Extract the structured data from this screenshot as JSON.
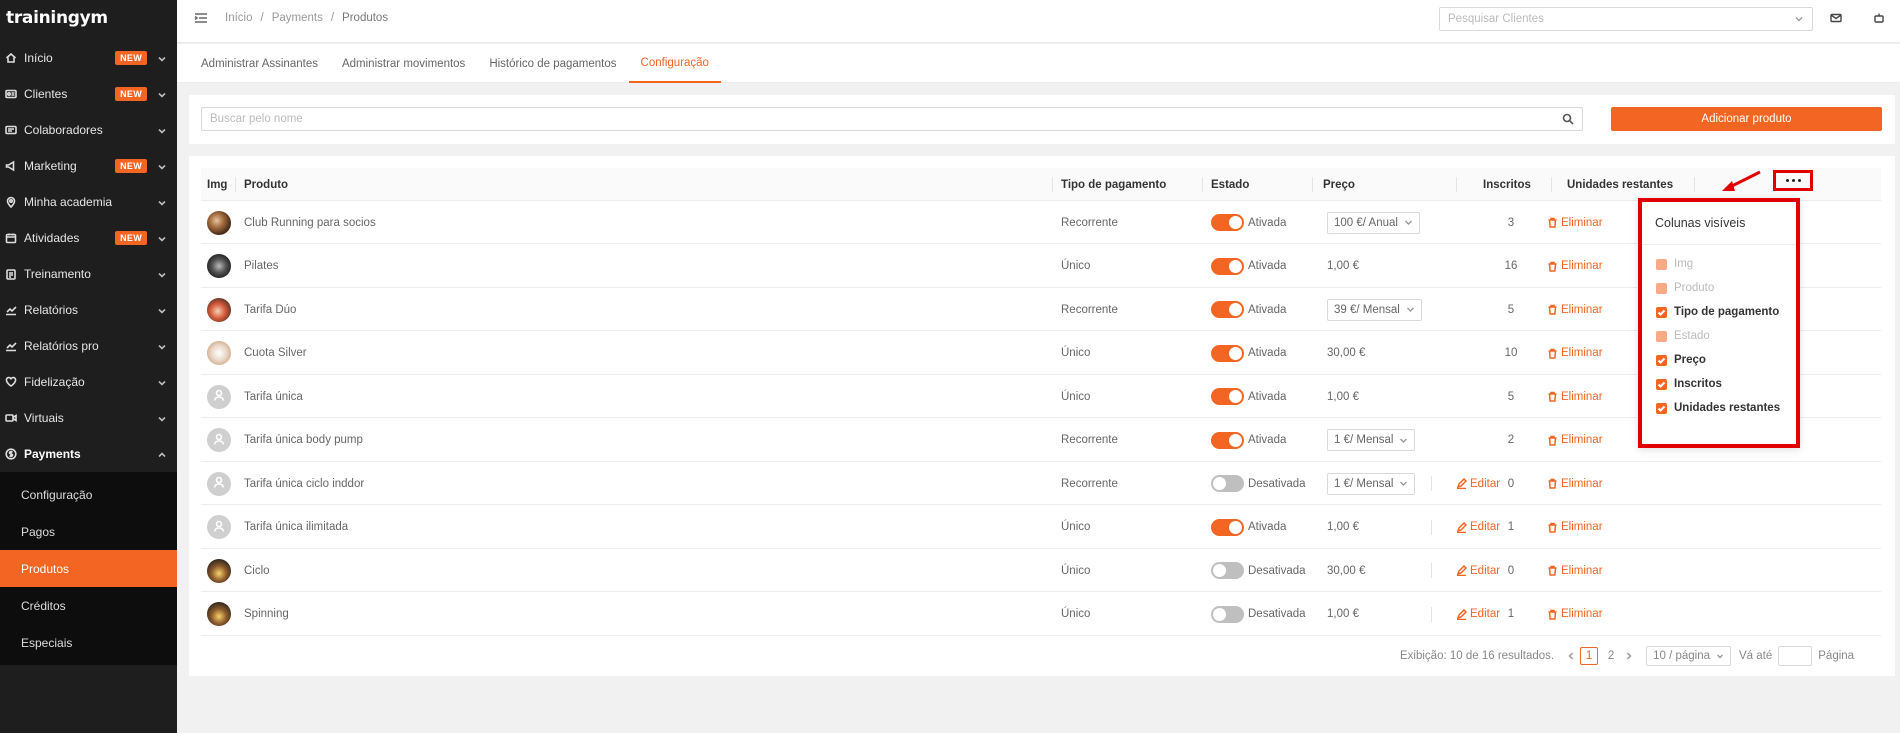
{
  "app": {
    "logo": "trainingym"
  },
  "sidebar": {
    "items": [
      {
        "label": "Início",
        "badge": "NEW",
        "icon": "home-icon"
      },
      {
        "label": "Clientes",
        "badge": "NEW",
        "icon": "id-card-icon"
      },
      {
        "label": "Colaboradores",
        "badge": "",
        "icon": "id-badge-icon"
      },
      {
        "label": "Marketing",
        "badge": "NEW",
        "icon": "megaphone-icon"
      },
      {
        "label": "Minha academia",
        "badge": "",
        "icon": "location-pin-icon"
      },
      {
        "label": "Atividades",
        "badge": "NEW",
        "icon": "calendar-icon"
      },
      {
        "label": "Treinamento",
        "badge": "",
        "icon": "clipboard-icon"
      },
      {
        "label": "Relatórios",
        "badge": "",
        "icon": "line-chart-icon"
      },
      {
        "label": "Relatórios pro",
        "badge": "",
        "icon": "line-chart-icon"
      },
      {
        "label": "Fidelização",
        "badge": "",
        "icon": "heart-icon"
      },
      {
        "label": "Virtuais",
        "badge": "",
        "icon": "video-icon"
      },
      {
        "label": "Payments",
        "badge": "",
        "icon": "dollar-icon"
      }
    ],
    "payments_sub": [
      "Configuração",
      "Pagos",
      "Produtos",
      "Créditos",
      "Especiais"
    ]
  },
  "topbar": {
    "breadcrumb": [
      "Início",
      "/",
      "Payments",
      "/",
      "Produtos"
    ],
    "search_placeholder": "Pesquisar Clientes"
  },
  "tabs": [
    "Administrar Assinantes",
    "Administrar movimentos",
    "Histórico de pagamentos",
    "Configuração"
  ],
  "search": {
    "placeholder": "Buscar pelo nome",
    "add_button": "Adicionar produto"
  },
  "table": {
    "headers": {
      "img": "Img",
      "produto": "Produto",
      "tipo": "Tipo de pagamento",
      "estado": "Estado",
      "preco": "Preço",
      "inscritos": "Inscritos",
      "unidades": "Unidades restantes"
    },
    "actions": {
      "edit": "Editar",
      "delete": "Eliminar"
    },
    "rows": [
      {
        "name": "Club Running para socios",
        "tipo": "Recorrente",
        "on": true,
        "estado": "Ativada",
        "price": "100 €/ Anual",
        "price_select": true,
        "inscritos": "3",
        "avatar": "photo"
      },
      {
        "name": "Pilates",
        "tipo": "Único",
        "on": true,
        "estado": "Ativada",
        "price": "1,00 €",
        "price_select": false,
        "inscritos": "16",
        "avatar": "photo2"
      },
      {
        "name": "Tarifa Dúo",
        "tipo": "Recorrente",
        "on": true,
        "estado": "Ativada",
        "price": "39 €/ Mensal",
        "price_select": true,
        "inscritos": "5",
        "avatar": "photo3"
      },
      {
        "name": "Cuota Silver",
        "tipo": "Único",
        "on": true,
        "estado": "Ativada",
        "price": "30,00 €",
        "price_select": false,
        "inscritos": "10",
        "avatar": "photo4"
      },
      {
        "name": "Tarifa única",
        "tipo": "Único",
        "on": true,
        "estado": "Ativada",
        "price": "1,00 €",
        "price_select": false,
        "inscritos": "5",
        "avatar": "gray"
      },
      {
        "name": "Tarifa única body pump",
        "tipo": "Recorrente",
        "on": true,
        "estado": "Ativada",
        "price": "1 €/ Mensal",
        "price_select": true,
        "inscritos": "2",
        "avatar": "gray"
      },
      {
        "name": "Tarifa única ciclo inddor",
        "tipo": "Recorrente",
        "on": false,
        "estado": "Desativada",
        "price": "1 €/ Mensal",
        "price_select": true,
        "inscritos": "0",
        "avatar": "gray"
      },
      {
        "name": "Tarifa única ilimitada",
        "tipo": "Único",
        "on": true,
        "estado": "Ativada",
        "price": "1,00 €",
        "price_select": false,
        "inscritos": "1",
        "avatar": "gray"
      },
      {
        "name": "Ciclo",
        "tipo": "Único",
        "on": false,
        "estado": "Desativada",
        "price": "30,00 €",
        "price_select": false,
        "inscritos": "0",
        "avatar": "photo5"
      },
      {
        "name": "Spinning",
        "tipo": "Único",
        "on": false,
        "estado": "Desativada",
        "price": "1,00 €",
        "price_select": false,
        "inscritos": "1",
        "avatar": "photo5"
      }
    ]
  },
  "columns_popup": {
    "title": "Colunas visíveis",
    "options": [
      {
        "label": "Img",
        "disabled": true
      },
      {
        "label": "Produto",
        "disabled": true
      },
      {
        "label": "Tipo de pagamento",
        "disabled": false
      },
      {
        "label": "Estado",
        "disabled": true
      },
      {
        "label": "Preço",
        "disabled": false
      },
      {
        "label": "Inscritos",
        "disabled": false
      },
      {
        "label": "Unidades restantes",
        "disabled": false
      }
    ]
  },
  "pagination": {
    "summary": "Exibição: 10 de 16 resultados.",
    "pages": [
      "1",
      "2"
    ],
    "per_page": "10 / página",
    "goto_label": "Vá até",
    "page_label": "Página"
  },
  "colors": {
    "accent": "#f26522",
    "sidebar_bg": "#1e1e1e",
    "highlight": "#e00000"
  }
}
